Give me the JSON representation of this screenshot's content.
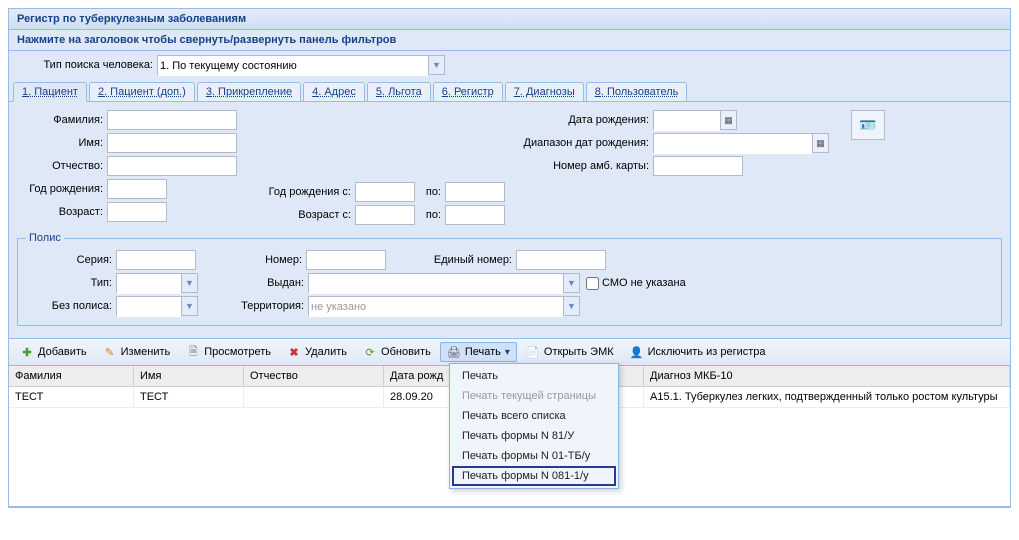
{
  "window": {
    "title": "Регистр по туберкулезным заболеваниям"
  },
  "filter": {
    "heading": "Нажмите на заголовок чтобы свернуть/развернуть панель фильтров",
    "search_type_label": "Тип поиска человека:",
    "search_type_value": "1. По текущему состоянию"
  },
  "tabs": [
    {
      "p": "1",
      "l": ". Пациент"
    },
    {
      "p": "2",
      "l": ". Пациент (доп.)"
    },
    {
      "p": "3",
      "l": ". Прикрепление"
    },
    {
      "p": "4",
      "l": ". Адрес"
    },
    {
      "p": "5",
      "l": ". Льгота"
    },
    {
      "p": "6",
      "l": ". Регистр"
    },
    {
      "p": "7",
      "l": ". Диагнозы"
    },
    {
      "p": "8",
      "l": ". Пользователь"
    }
  ],
  "patient": {
    "lastname": "Фамилия:",
    "firstname": "Имя:",
    "midname": "Отчество:",
    "birthyear": "Год рождения:",
    "age": "Возраст:",
    "birthyear_from": "Год рождения с:",
    "age_from": "Возраст с:",
    "to": "по:",
    "birthdate": "Дата рождения:",
    "birthdate_range": "Диапазон дат рождения:",
    "card_no": "Номер амб. карты:"
  },
  "polis": {
    "legend": "Полис",
    "series": "Серия:",
    "number": "Номер:",
    "unified": "Единый номер:",
    "type": "Тип:",
    "issued": "Выдан:",
    "no_smo": "СМО не указана",
    "no_polis": "Без полиса:",
    "territory": "Территория:",
    "territory_ph": "не указано"
  },
  "toolbar": {
    "add": "Добавить",
    "edit": "Изменить",
    "view": "Просмотреть",
    "delete": "Удалить",
    "refresh": "Обновить",
    "print": "Печать",
    "open_emk": "Открыть ЭМК",
    "exclude": "Исключить из регистра"
  },
  "menu": {
    "items": [
      {
        "label": "Печать",
        "disabled": false
      },
      {
        "label": "Печать текущей страницы",
        "disabled": true
      },
      {
        "label": "Печать всего списка",
        "disabled": false
      },
      {
        "label": "Печать формы N 81/У",
        "disabled": false
      },
      {
        "label": "Печать формы N 01-ТБ/у",
        "disabled": false
      },
      {
        "label": "Печать формы N 081-1/у",
        "disabled": false,
        "selected": true
      }
    ]
  },
  "grid": {
    "cols": [
      "Фамилия",
      "Имя",
      "Отчество",
      "Дата рожд",
      "",
      "Диагноз МКБ-10"
    ],
    "row": {
      "lastname": "ТЕСТ",
      "firstname": "ТЕСТ",
      "midname": "",
      "birthdate": "28.09.20",
      "diag": "A15.1. Туберкулез легких, подтвержденный только ростом культуры"
    }
  }
}
